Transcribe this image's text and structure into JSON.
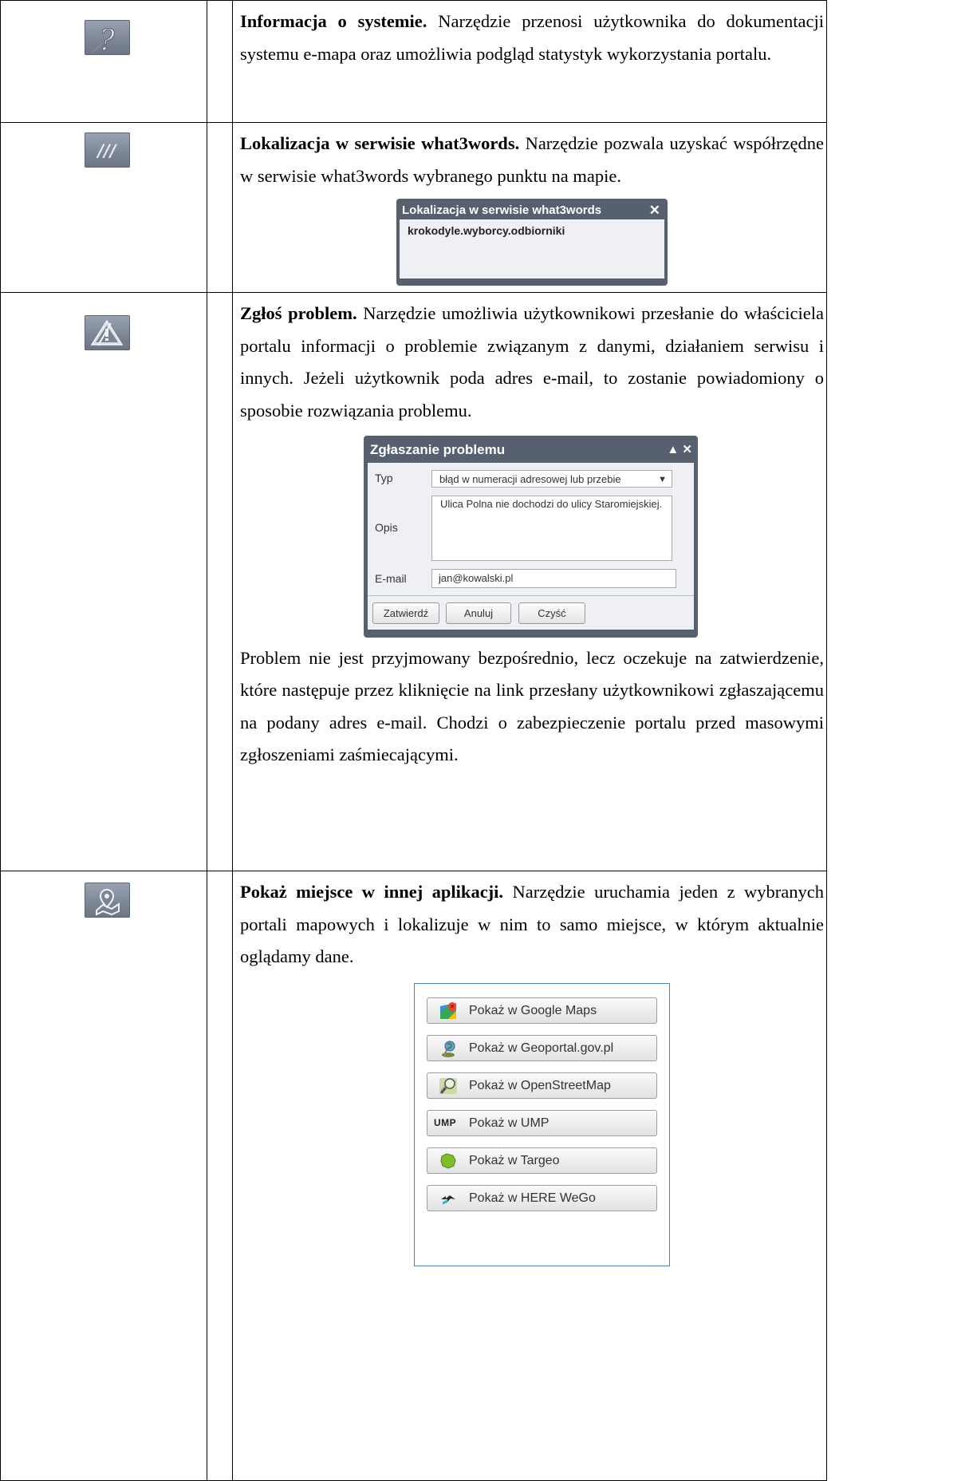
{
  "rows": [
    {
      "icon": "question-mark-icon",
      "title": "Informacja o systemie.",
      "text": " Narzędzie przenosi użytkownika do dokumentacji systemu e-mapa oraz umożliwia podgląd statystyk wykorzystania portalu."
    },
    {
      "icon": "what3words-icon",
      "title": "Lokalizacja w serwisie what3words.",
      "text": " Narzędzie pozwala uzyskać współrzędne w serwisie what3words wybranego punktu na mapie.",
      "dialog": {
        "title": "Lokalizacja w serwisie what3words",
        "close": "✕",
        "value": "krokodyle.wyborcy.odbiorniki"
      }
    },
    {
      "icon": "warning-icon",
      "title": "Zgłoś problem.",
      "text": " Narzędzie umożliwia użytkownikowi przesłanie do właściciela portalu informacji o problemie związanym z danymi, działaniem serwisu i innych. Jeżeli użytkownik poda adres e-mail, to zostanie powiadomiony o sposobie rozwiązania problemu.",
      "dialog": {
        "title": "Zgłaszanie problemu",
        "controls": "▲ ✕",
        "type_label": "Typ",
        "type_value": "błąd w numeracji adresowej lub przebie",
        "desc_label": "Opis",
        "desc_value": "Ulica Polna nie dochodzi do ulicy Staromiejskiej.",
        "email_label": "E-mail",
        "email_value": "jan@kowalski.pl",
        "btn_confirm": "Zatwierdź",
        "btn_cancel": "Anuluj",
        "btn_clear": "Czyść"
      },
      "text2": "Problem nie jest przyjmowany bezpośrednio, lecz oczekuje na zatwierdzenie, które następuje przez kliknięcie na link przesłany użytkownikowi zgłaszającemu na podany adres e-mail. Chodzi o zabezpieczenie portalu przed masowymi zgłoszeniami zaśmiecającymi."
    },
    {
      "icon": "map-pin-icon",
      "title": "Pokaż miejsce w innej aplikacji.",
      "text": " Narzędzie uruchamia jeden z wybranych portali mapowych i lokalizuje w nim to samo miejsce, w którym aktualnie oglądamy dane.",
      "buttons": [
        "Pokaż w Google Maps",
        "Pokaż w Geoportal.gov.pl",
        "Pokaż w OpenStreetMap",
        "Pokaż w UMP",
        "Pokaż w Targeo",
        "Pokaż w HERE WeGo"
      ],
      "ump_logo": "UMP"
    }
  ]
}
